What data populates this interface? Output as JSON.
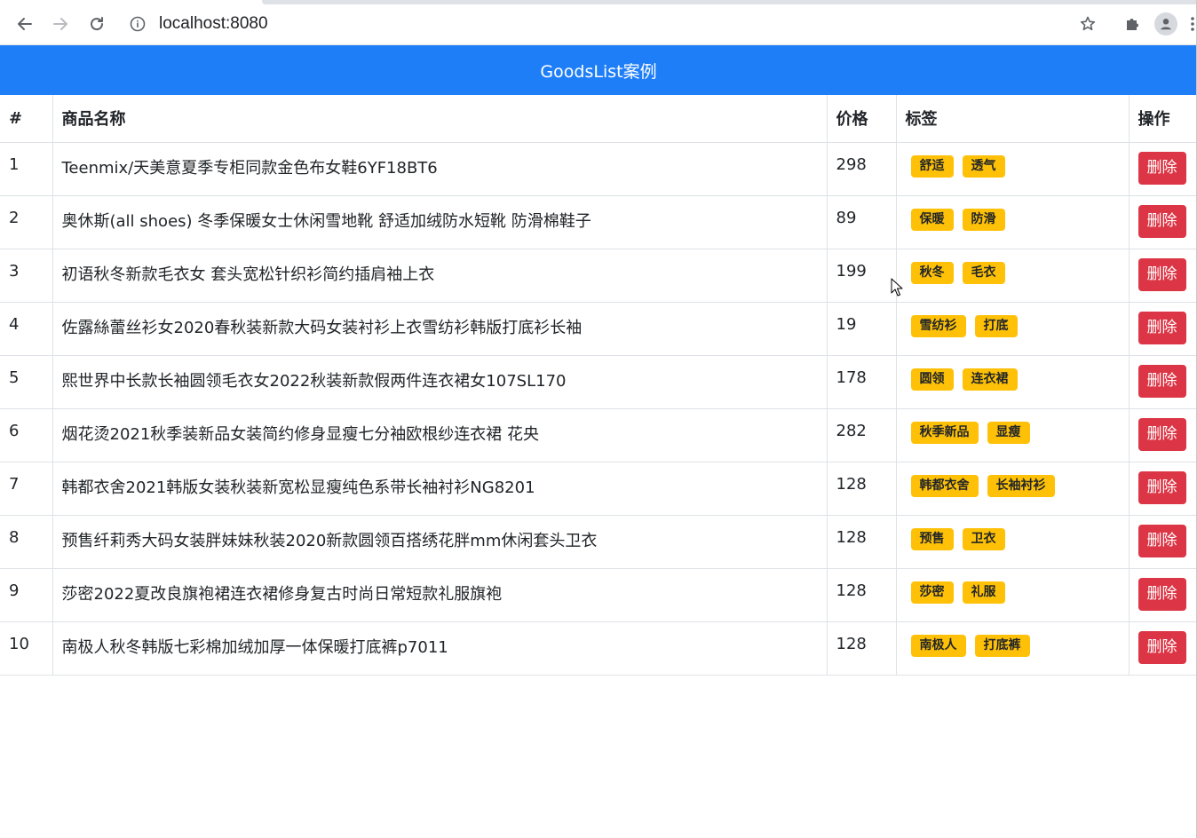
{
  "browser": {
    "url": "localhost:8080"
  },
  "app": {
    "title": "GoodsList案例"
  },
  "table": {
    "headers": {
      "index": "#",
      "name": "商品名称",
      "price": "价格",
      "tags": "标签",
      "action": "操作"
    },
    "delete_label": "删除",
    "rows": [
      {
        "id": "1",
        "name": "Teenmix/天美意夏季专柜同款金色布女鞋6YF18BT6",
        "price": "298",
        "tags": [
          "舒适",
          "透气"
        ]
      },
      {
        "id": "2",
        "name": "奥休斯(all shoes) 冬季保暖女士休闲雪地靴 舒适加绒防水短靴 防滑棉鞋子",
        "price": "89",
        "tags": [
          "保暖",
          "防滑"
        ]
      },
      {
        "id": "3",
        "name": "初语秋冬新款毛衣女 套头宽松针织衫简约插肩袖上衣",
        "price": "199",
        "tags": [
          "秋冬",
          "毛衣"
        ]
      },
      {
        "id": "4",
        "name": "佐露絲蕾丝衫女2020春秋装新款大码女装衬衫上衣雪纺衫韩版打底衫长袖",
        "price": "19",
        "tags": [
          "雪纺衫",
          "打底"
        ]
      },
      {
        "id": "5",
        "name": "熙世界中长款长袖圆领毛衣女2022秋装新款假两件连衣裙女107SL170",
        "price": "178",
        "tags": [
          "圆领",
          "连衣裙"
        ]
      },
      {
        "id": "6",
        "name": "烟花烫2021秋季装新品女装简约修身显瘦七分袖欧根纱连衣裙 花央",
        "price": "282",
        "tags": [
          "秋季新品",
          "显瘦"
        ]
      },
      {
        "id": "7",
        "name": "韩都衣舍2021韩版女装秋装新宽松显瘦纯色系带长袖衬衫NG8201",
        "price": "128",
        "tags": [
          "韩都衣舍",
          "长袖衬衫"
        ]
      },
      {
        "id": "8",
        "name": "预售纤莉秀大码女装胖妹妹秋装2020新款圆领百搭绣花胖mm休闲套头卫衣",
        "price": "128",
        "tags": [
          "预售",
          "卫衣"
        ]
      },
      {
        "id": "9",
        "name": "莎密2022夏改良旗袍裙连衣裙修身复古时尚日常短款礼服旗袍",
        "price": "128",
        "tags": [
          "莎密",
          "礼服"
        ]
      },
      {
        "id": "10",
        "name": "南极人秋冬韩版七彩棉加绒加厚一体保暖打底裤p7011",
        "price": "128",
        "tags": [
          "南极人",
          "打底裤"
        ]
      }
    ]
  }
}
